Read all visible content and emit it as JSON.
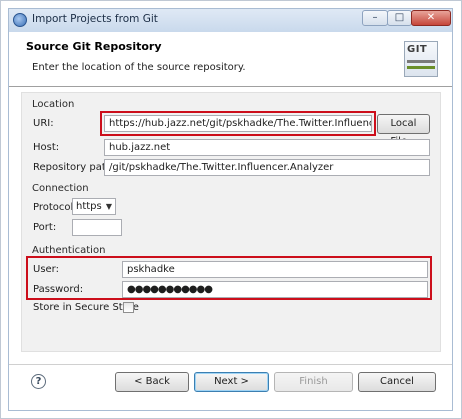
{
  "window": {
    "title": "Import Projects from Git",
    "minimize_glyph": "–",
    "maximize_glyph": "□",
    "close_glyph": "✕"
  },
  "header": {
    "title": "Source Git Repository",
    "description": "Enter the location of the source repository.",
    "logo_text": "GIT"
  },
  "location": {
    "group_label": "Location",
    "uri_label": "URI:",
    "uri_value": "https://hub.jazz.net/git/pskhadke/The.Twitter.Influencer.Analyzer",
    "local_file_button": "Local File...",
    "host_label": "Host:",
    "host_value": "hub.jazz.net",
    "repo_path_label": "Repository path:",
    "repo_path_value": "/git/pskhadke/The.Twitter.Influencer.Analyzer"
  },
  "connection": {
    "group_label": "Connection",
    "protocol_label": "Protocol:",
    "protocol_value": "https",
    "port_label": "Port:",
    "port_value": ""
  },
  "authentication": {
    "group_label": "Authentication",
    "user_label": "User:",
    "user_value": "pskhadke",
    "password_label": "Password:",
    "password_value": "●●●●●●●●●●●",
    "store_label": "Store in Secure Store"
  },
  "footer": {
    "help_glyph": "?",
    "back_button": "< Back",
    "next_button": "Next >",
    "finish_button": "Finish",
    "cancel_button": "Cancel"
  },
  "colors": {
    "highlight_border": "#cc0e1b",
    "title_bar": "#c9d9ec",
    "content_background": "#f1f1f1"
  }
}
